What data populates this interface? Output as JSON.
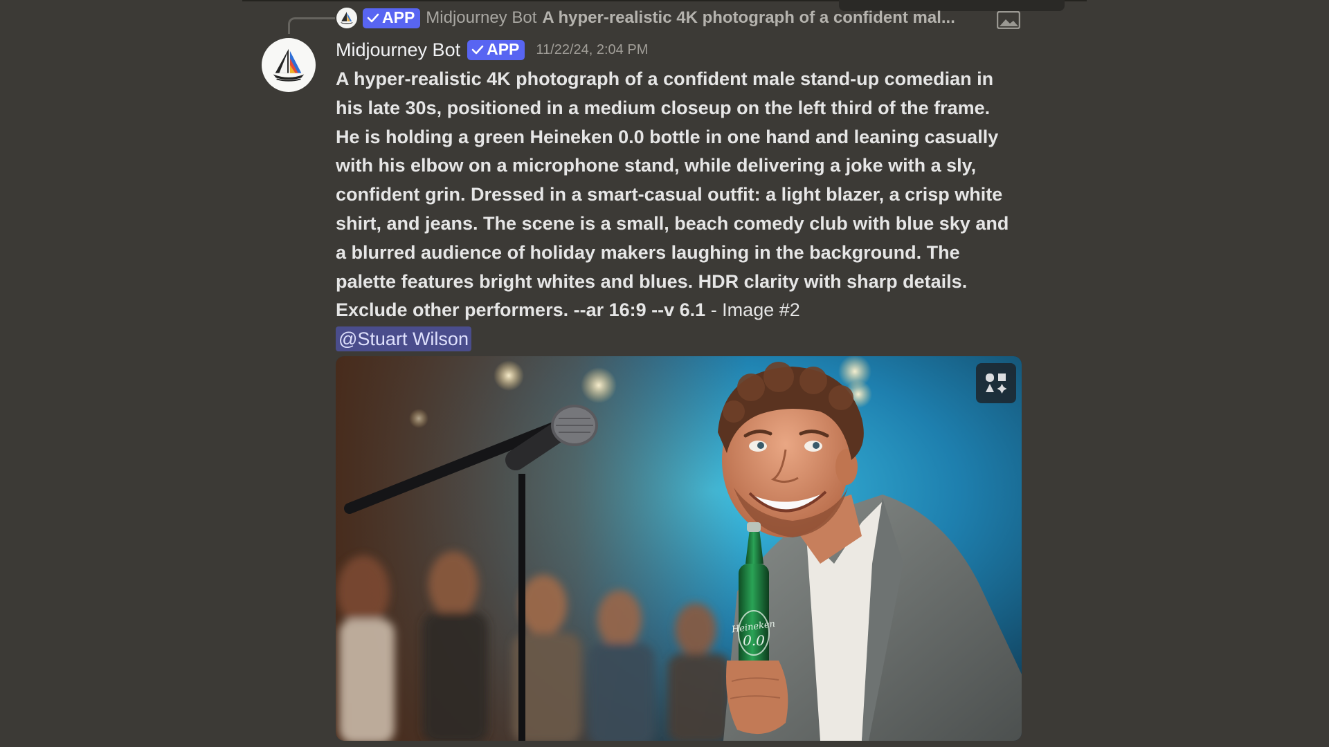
{
  "reply": {
    "app_badge": "APP",
    "author": "Midjourney Bot",
    "text": "A hyper-realistic 4K photograph of a confident mal..."
  },
  "message": {
    "username": "Midjourney Bot",
    "app_badge": "APP",
    "timestamp": "11/22/24, 2:04 PM",
    "prompt": "A hyper-realistic 4K photograph of a confident male stand-up comedian in his late 30s, positioned in a medium closeup on the left third of the frame. He is holding a green Heineken 0.0 bottle in one hand and leaning casually with his elbow on a microphone stand, while delivering a joke with a sly, confident grin. Dressed in a smart-casual outfit: a light blazer, a crisp white shirt, and jeans. The scene is a small, beach comedy club with blue sky and a blurred audience of holiday makers laughing in the background. The palette features bright whites and blues. HDR clarity with sharp details. Exclude other performers. --ar 16:9 --v 6.1",
    "image_suffix": " - Image #2",
    "mention": "@Stuart Wilson"
  },
  "attachment": {
    "bottle_label": "Heineken 0.0",
    "remix_icon": "remix-shapes-icon"
  },
  "colors": {
    "background": "#3c3a36",
    "app_badge": "#5865f2",
    "mention_bg": "#4a4d8c",
    "bottle_green": "#1f7a3a"
  }
}
